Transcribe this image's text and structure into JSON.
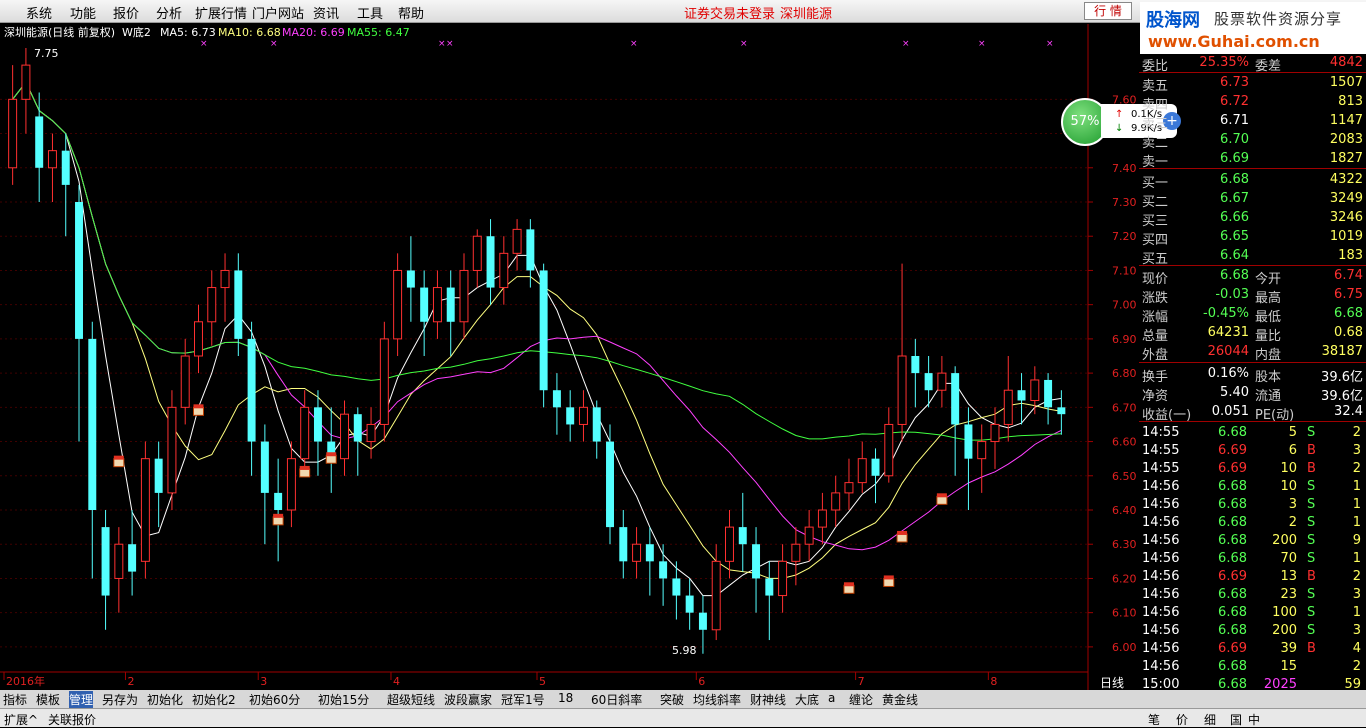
{
  "menu": [
    "系统",
    "功能",
    "报价",
    "分析",
    "扩展行情",
    "门户网站",
    "资讯",
    "工具",
    "帮助"
  ],
  "center_title": {
    "status": "证券交易未登录",
    "stock": "深圳能源"
  },
  "right_buttons": {
    "quote": "行 情"
  },
  "logo": {
    "name": "股海网",
    "slogan": "股票软件资源分享",
    "url": "www.Guhai.com.cn"
  },
  "chart_header": {
    "name": "深圳能源(日线 前复权)",
    "indicator": "W底2",
    "ma5": "MA5: 6.73",
    "ma10": "MA10: 6.68",
    "ma20": "MA20: 6.69",
    "ma55": "MA55: 6.47"
  },
  "chart_data": {
    "type": "candlestick",
    "ylim": [
      5.95,
      7.75
    ],
    "yticks": [
      "7.60",
      "7.50",
      "7.40",
      "7.30",
      "7.20",
      "7.10",
      "7.00",
      "6.90",
      "6.80",
      "6.70",
      "6.60",
      "6.50",
      "6.40",
      "6.30",
      "6.20",
      "6.10",
      "6.00"
    ],
    "xlabels": [
      "2016年",
      "2",
      "3",
      "4",
      "5",
      "6",
      "7",
      "8"
    ],
    "period_label": "日线",
    "annotations": {
      "high": "7.75",
      "low": "5.98"
    },
    "colors": {
      "up": "#ff3030",
      "down": "#54ffff",
      "ma5": "#ffffff",
      "ma10": "#ffff80",
      "ma20": "#ff40ff",
      "ma55": "#40ff40"
    },
    "candles": [
      [
        7.4,
        7.6,
        7.7,
        7.35
      ],
      [
        7.6,
        7.7,
        7.75,
        7.5
      ],
      [
        7.55,
        7.4,
        7.62,
        7.3
      ],
      [
        7.4,
        7.45,
        7.5,
        7.3
      ],
      [
        7.45,
        7.35,
        7.5,
        7.2
      ],
      [
        7.3,
        6.9,
        7.35,
        6.6
      ],
      [
        6.9,
        6.4,
        6.95,
        6.2
      ],
      [
        6.35,
        6.15,
        6.4,
        6.05
      ],
      [
        6.2,
        6.3,
        6.35,
        6.1
      ],
      [
        6.3,
        6.22,
        6.4,
        6.15
      ],
      [
        6.25,
        6.55,
        6.6,
        6.2
      ],
      [
        6.55,
        6.45,
        6.6,
        6.35
      ],
      [
        6.45,
        6.7,
        6.75,
        6.4
      ],
      [
        6.7,
        6.85,
        6.9,
        6.65
      ],
      [
        6.85,
        6.95,
        7.0,
        6.8
      ],
      [
        6.95,
        7.05,
        7.1,
        6.88
      ],
      [
        7.05,
        7.1,
        7.15,
        6.95
      ],
      [
        7.1,
        6.9,
        7.15,
        6.85
      ],
      [
        6.9,
        6.6,
        6.95,
        6.5
      ],
      [
        6.6,
        6.45,
        6.65,
        6.3
      ],
      [
        6.45,
        6.4,
        6.55,
        6.25
      ],
      [
        6.4,
        6.55,
        6.6,
        6.35
      ],
      [
        6.55,
        6.7,
        6.75,
        6.5
      ],
      [
        6.7,
        6.6,
        6.75,
        6.5
      ],
      [
        6.6,
        6.55,
        6.7,
        6.45
      ],
      [
        6.55,
        6.68,
        6.72,
        6.5
      ],
      [
        6.68,
        6.6,
        6.7,
        6.5
      ],
      [
        6.6,
        6.65,
        6.7,
        6.55
      ],
      [
        6.65,
        6.9,
        6.95,
        6.6
      ],
      [
        6.9,
        7.1,
        7.15,
        6.85
      ],
      [
        7.1,
        7.05,
        7.2,
        6.95
      ],
      [
        7.05,
        6.95,
        7.1,
        6.85
      ],
      [
        6.95,
        7.05,
        7.1,
        6.9
      ],
      [
        7.05,
        6.95,
        7.1,
        6.85
      ],
      [
        6.95,
        7.1,
        7.15,
        6.9
      ],
      [
        7.1,
        7.2,
        7.22,
        7.05
      ],
      [
        7.2,
        7.05,
        7.25,
        7.0
      ],
      [
        7.05,
        7.15,
        7.2,
        7.0
      ],
      [
        7.15,
        7.22,
        7.25,
        7.1
      ],
      [
        7.22,
        7.1,
        7.25,
        7.05
      ],
      [
        7.1,
        6.75,
        7.12,
        6.7
      ],
      [
        6.75,
        6.7,
        6.8,
        6.62
      ],
      [
        6.7,
        6.65,
        6.75,
        6.6
      ],
      [
        6.65,
        6.7,
        6.75,
        6.6
      ],
      [
        6.7,
        6.6,
        6.72,
        6.55
      ],
      [
        6.6,
        6.35,
        6.65,
        6.3
      ],
      [
        6.35,
        6.25,
        6.4,
        6.2
      ],
      [
        6.25,
        6.3,
        6.35,
        6.2
      ],
      [
        6.3,
        6.25,
        6.35,
        6.15
      ],
      [
        6.25,
        6.2,
        6.3,
        6.12
      ],
      [
        6.2,
        6.15,
        6.25,
        6.08
      ],
      [
        6.15,
        6.1,
        6.2,
        6.05
      ],
      [
        6.1,
        6.05,
        6.15,
        5.98
      ],
      [
        6.05,
        6.25,
        6.3,
        6.02
      ],
      [
        6.25,
        6.35,
        6.4,
        6.2
      ],
      [
        6.35,
        6.3,
        6.45,
        6.22
      ],
      [
        6.3,
        6.2,
        6.35,
        6.1
      ],
      [
        6.2,
        6.15,
        6.25,
        6.02
      ],
      [
        6.15,
        6.25,
        6.3,
        6.1
      ],
      [
        6.25,
        6.3,
        6.35,
        6.18
      ],
      [
        6.3,
        6.35,
        6.4,
        6.25
      ],
      [
        6.35,
        6.4,
        6.45,
        6.3
      ],
      [
        6.4,
        6.45,
        6.5,
        6.35
      ],
      [
        6.45,
        6.48,
        6.55,
        6.4
      ],
      [
        6.48,
        6.55,
        6.6,
        6.45
      ],
      [
        6.55,
        6.5,
        6.58,
        6.42
      ],
      [
        6.5,
        6.65,
        6.7,
        6.48
      ],
      [
        6.65,
        6.85,
        7.12,
        6.6
      ],
      [
        6.85,
        6.8,
        6.9,
        6.7
      ],
      [
        6.8,
        6.75,
        6.85,
        6.7
      ],
      [
        6.75,
        6.8,
        6.85,
        6.7
      ],
      [
        6.8,
        6.65,
        6.82,
        6.5
      ],
      [
        6.65,
        6.55,
        6.7,
        6.4
      ],
      [
        6.55,
        6.6,
        6.65,
        6.45
      ],
      [
        6.6,
        6.65,
        6.7,
        6.52
      ],
      [
        6.65,
        6.75,
        6.85,
        6.6
      ],
      [
        6.75,
        6.72,
        6.8,
        6.65
      ],
      [
        6.72,
        6.78,
        6.82,
        6.68
      ],
      [
        6.78,
        6.7,
        6.8,
        6.65
      ],
      [
        6.7,
        6.68,
        6.75,
        6.62
      ]
    ]
  },
  "panel": {
    "top_row": {
      "l1": "委比",
      "v1": "25.35%",
      "l2": "委差",
      "v2": "4842"
    },
    "sells": [
      {
        "label": "卖五",
        "price": "6.73",
        "vol": "1507"
      },
      {
        "label": "卖四",
        "price": "6.72",
        "vol": "813"
      },
      {
        "label": "卖三",
        "price": "6.71",
        "vol": "1147"
      },
      {
        "label": "卖二",
        "price": "6.70",
        "vol": "2083"
      },
      {
        "label": "卖一",
        "price": "6.69",
        "vol": "1827"
      }
    ],
    "buys": [
      {
        "label": "买一",
        "price": "6.68",
        "vol": "4322"
      },
      {
        "label": "买二",
        "price": "6.67",
        "vol": "3249"
      },
      {
        "label": "买三",
        "price": "6.66",
        "vol": "3246"
      },
      {
        "label": "买四",
        "price": "6.65",
        "vol": "1019"
      },
      {
        "label": "买五",
        "price": "6.64",
        "vol": "183"
      }
    ],
    "stats": [
      {
        "l1": "现价",
        "v1": "6.68",
        "l2": "今开",
        "v2": "6.74"
      },
      {
        "l1": "涨跌",
        "v1": "-0.03",
        "l2": "最高",
        "v2": "6.75"
      },
      {
        "l1": "涨幅",
        "v1": "-0.45%",
        "l2": "最低",
        "v2": "6.68"
      },
      {
        "l1": "总量",
        "v1": "64231",
        "l2": "量比",
        "v2": "0.68"
      },
      {
        "l1": "外盘",
        "v1": "26044",
        "l2": "内盘",
        "v2": "38187"
      }
    ],
    "stats2": [
      {
        "l1": "换手",
        "v1": "0.16%",
        "l2": "股本",
        "v2": "39.6亿"
      },
      {
        "l1": "净资",
        "v1": "5.40",
        "l2": "流通",
        "v2": "39.6亿"
      },
      {
        "l1": "收益(一)",
        "v1": "0.051",
        "l2": "PE(动)",
        "v2": "32.4"
      }
    ],
    "ticks": [
      {
        "t": "14:55",
        "p": "6.68",
        "v": "5",
        "s": "S",
        "n": "2"
      },
      {
        "t": "14:55",
        "p": "6.69",
        "v": "6",
        "s": "B",
        "n": "3"
      },
      {
        "t": "14:55",
        "p": "6.69",
        "v": "10",
        "s": "B",
        "n": "2"
      },
      {
        "t": "14:56",
        "p": "6.68",
        "v": "10",
        "s": "S",
        "n": "1"
      },
      {
        "t": "14:56",
        "p": "6.68",
        "v": "3",
        "s": "S",
        "n": "1"
      },
      {
        "t": "14:56",
        "p": "6.68",
        "v": "2",
        "s": "S",
        "n": "1"
      },
      {
        "t": "14:56",
        "p": "6.68",
        "v": "200",
        "s": "S",
        "n": "9"
      },
      {
        "t": "14:56",
        "p": "6.68",
        "v": "70",
        "s": "S",
        "n": "1"
      },
      {
        "t": "14:56",
        "p": "6.69",
        "v": "13",
        "s": "B",
        "n": "2"
      },
      {
        "t": "14:56",
        "p": "6.68",
        "v": "23",
        "s": "S",
        "n": "3"
      },
      {
        "t": "14:56",
        "p": "6.68",
        "v": "100",
        "s": "S",
        "n": "1"
      },
      {
        "t": "14:56",
        "p": "6.68",
        "v": "200",
        "s": "S",
        "n": "3"
      },
      {
        "t": "14:56",
        "p": "6.69",
        "v": "39",
        "s": "B",
        "n": "4"
      },
      {
        "t": "14:56",
        "p": "6.68",
        "v": "15",
        "s": "",
        "n": "2"
      },
      {
        "t": "15:00",
        "p": "6.68",
        "v": "2025",
        "s": "",
        "n": "59"
      }
    ]
  },
  "widget": {
    "percent": "57%",
    "up": "0.1K/s",
    "down": "9.9K/s"
  },
  "bottom_tabs": [
    "指标",
    "模板",
    "管理",
    "另存为",
    "初始化",
    "初始化2",
    "初始60分",
    "初始15分",
    "超级短线",
    "波段赢家",
    "冠军1号",
    "18",
    "60日斜率",
    "突破",
    "均线斜率",
    "财神线",
    "大底",
    "a",
    "缠论",
    "黄金线"
  ],
  "status_items": [
    "扩展^",
    "关联报价"
  ],
  "status_right": [
    "笔",
    "价",
    "细",
    "国",
    "中"
  ]
}
